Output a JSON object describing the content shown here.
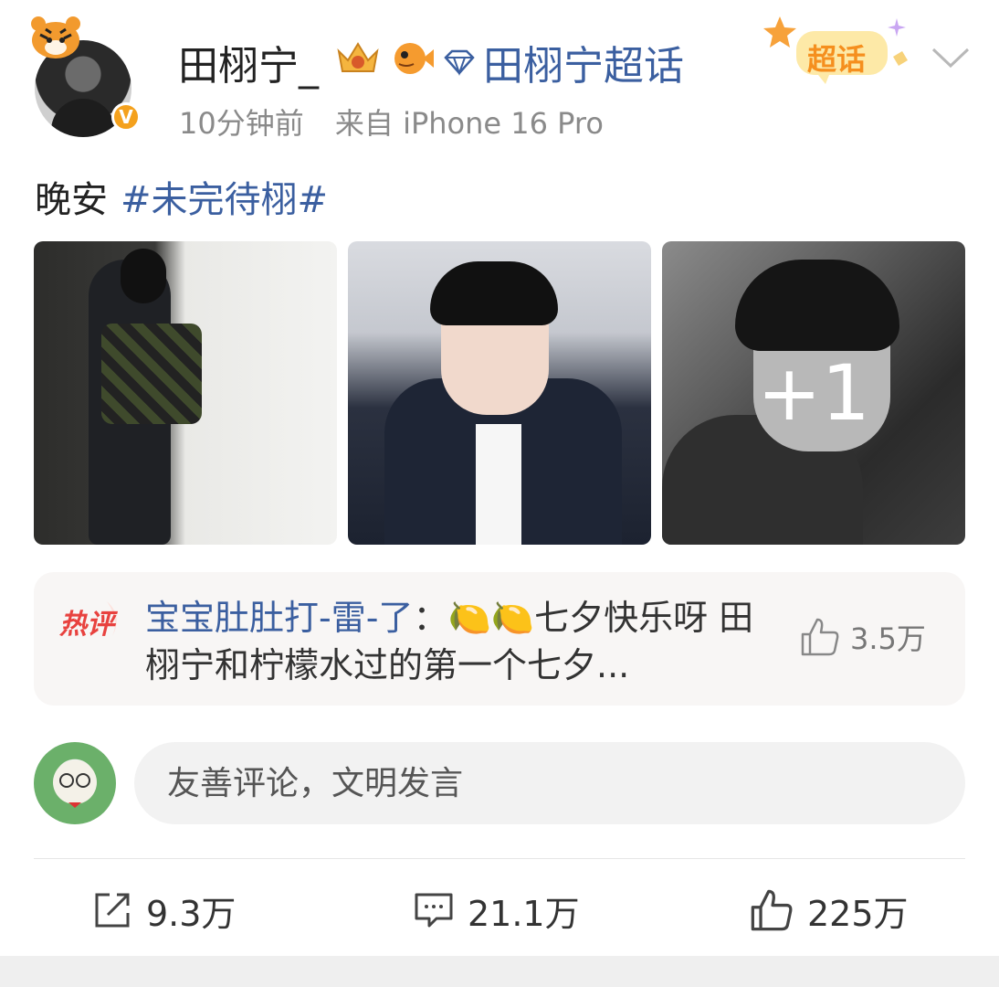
{
  "post": {
    "author": {
      "username": "田栩宁_",
      "verified_mark": "V",
      "supertopic_link": "田栩宁超话",
      "supertopic_badge": "超话"
    },
    "meta": {
      "time": "10分钟前",
      "source": "来自 iPhone 16 Pro"
    },
    "text": "晚安",
    "hashtag": "#未完待栩#",
    "images": {
      "more_count": "+1"
    },
    "hot_comment": {
      "label": "热评",
      "commenter": "宝宝肚肚打-雷-了",
      "separator": "：",
      "emoji": "🍋🍋",
      "content": "七夕快乐呀 田栩宁和柠檬水过的第一个七夕...",
      "likes": "3.5万"
    },
    "comment_input": {
      "placeholder": "友善评论，文明发言"
    },
    "actions": {
      "repost_count": "9.3万",
      "comment_count": "21.1万",
      "like_count": "225万"
    }
  },
  "colors": {
    "link_blue": "#3b5fa0",
    "verified_orange": "#f4a11d",
    "hot_label_red": "#e8423f",
    "meta_gray": "#8a8a8a"
  },
  "icons": [
    "tiger-icon",
    "verified-icon",
    "crown-badge-icon",
    "fish-badge-icon",
    "diamond-icon",
    "supertopic-icon",
    "chevron-down-icon",
    "thumbs-up-icon",
    "repost-icon",
    "comment-icon"
  ]
}
